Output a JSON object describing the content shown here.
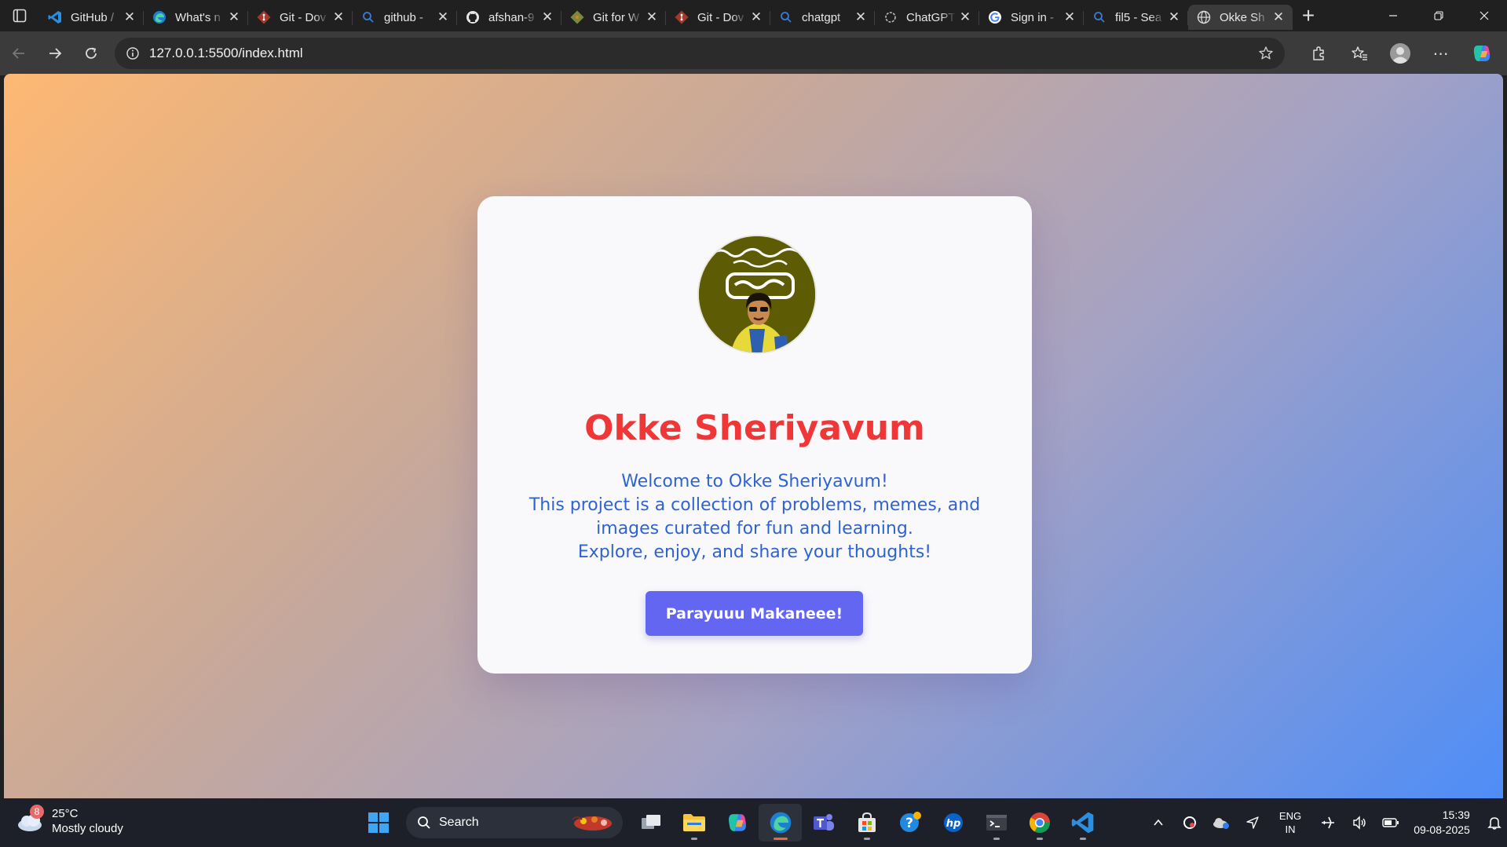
{
  "browser": {
    "tabs": [
      {
        "title": "GitHub /",
        "icon": "vscode-icon"
      },
      {
        "title": "What's n",
        "icon": "edge-icon"
      },
      {
        "title": "Git - Dov",
        "icon": "git-icon"
      },
      {
        "title": "github -",
        "icon": "search-icon"
      },
      {
        "title": "afshan-9",
        "icon": "github-icon"
      },
      {
        "title": "Git for W",
        "icon": "git-for-windows-icon"
      },
      {
        "title": "Git - Dov",
        "icon": "git-icon"
      },
      {
        "title": "chatgpt",
        "icon": "search-icon"
      },
      {
        "title": "ChatGPT",
        "icon": "chatgpt-icon"
      },
      {
        "title": "Sign in -",
        "icon": "google-icon"
      },
      {
        "title": "fil5 - Sea",
        "icon": "search-icon"
      },
      {
        "title": "Okke Sh",
        "icon": "globe-icon",
        "active": true
      }
    ],
    "address": "127.0.0.1:5500/index.html"
  },
  "page": {
    "title": "Okke Sheriyavum",
    "description": [
      "Welcome to Okke Sheriyavum!",
      "This project is a collection of problems, memes, and images curated for fun and learning.",
      "Explore, enjoy, and share your thoughts!"
    ],
    "cta_label": "Parayuuu Makaneee!",
    "accent": "#6366f1",
    "title_color": "#f03737",
    "text_color": "#2f63cf"
  },
  "taskbar": {
    "weather": {
      "temp": "25°C",
      "condition": "Mostly cloudy",
      "badge": "8"
    },
    "search_label": "Search",
    "language": {
      "line1": "ENG",
      "line2": "IN"
    },
    "clock": {
      "time": "15:39",
      "date": "09-08-2025"
    }
  }
}
